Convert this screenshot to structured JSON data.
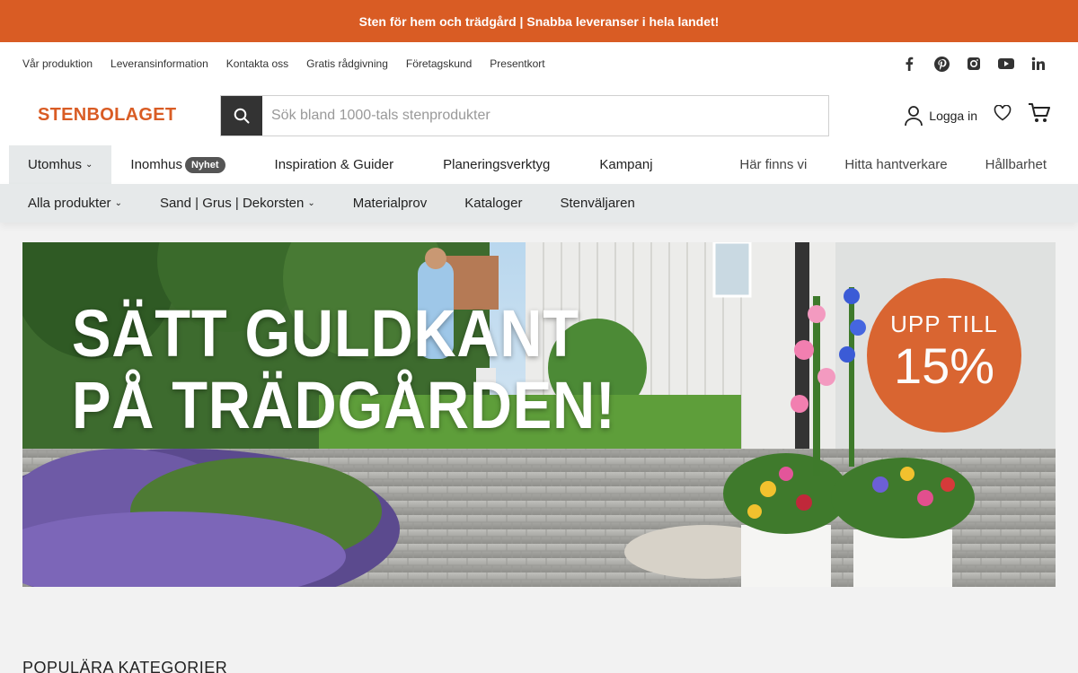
{
  "announcement": "Sten för hem och trädgård | Snabba leveranser i hela landet!",
  "top_links": [
    "Vår produktion",
    "Leveransinformation",
    "Kontakta oss",
    "Gratis rådgivning",
    "Företagskund",
    "Presentkort"
  ],
  "social_icons": [
    "facebook-icon",
    "pinterest-icon",
    "instagram-icon",
    "youtube-icon",
    "linkedin-icon"
  ],
  "logo": "STENBOLAGET",
  "search": {
    "placeholder": "Sök bland 1000-tals stenprodukter",
    "value": ""
  },
  "account": {
    "login_label": "Logga in"
  },
  "main_nav": {
    "left": [
      {
        "label": "Utomhus",
        "active": true,
        "dropdown": true
      },
      {
        "label": "Inomhus",
        "badge": "Nyhet"
      },
      {
        "label": "Inspiration & Guider"
      },
      {
        "label": "Planeringsverktyg"
      },
      {
        "label": "Kampanj"
      }
    ],
    "right": [
      "Här finns vi",
      "Hitta hantverkare",
      "Hållbarhet"
    ]
  },
  "sub_nav": [
    {
      "label": "Alla produkter",
      "dropdown": true
    },
    {
      "label": "Sand | Grus | Dekorsten",
      "dropdown": true
    },
    {
      "label": "Materialprov"
    },
    {
      "label": "Kataloger"
    },
    {
      "label": "Stenväljaren"
    }
  ],
  "hero": {
    "line1": "SÄTT GULDKANT",
    "line2": "PÅ TRÄDGÅRDEN!",
    "promo_line1": "UPP TILL",
    "promo_line2": "15%"
  },
  "section_title": "POPULÄRA KATEGORIER",
  "colors": {
    "brand": "#d95c24",
    "nav_bg": "#e6e9ea",
    "dark": "#333333"
  }
}
